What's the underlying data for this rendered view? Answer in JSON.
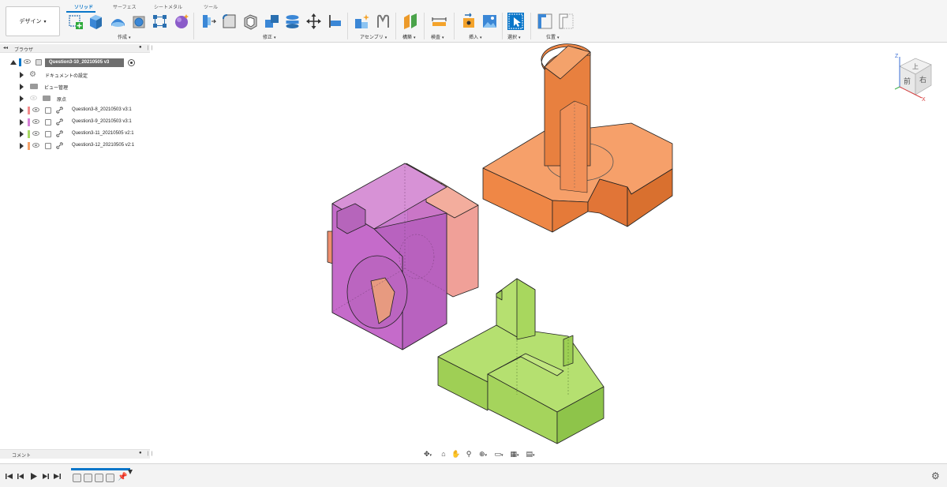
{
  "toolbar": {
    "workspace_label": "デザイン",
    "tabs": [
      "ソリッド",
      "サーフェス",
      "シートメタル",
      "ツール"
    ],
    "groups": [
      "作成",
      "修正",
      "アセンブリ",
      "構築",
      "検査",
      "挿入",
      "選択",
      "位置"
    ],
    "icon_names": {
      "create": [
        "create-sketch-icon",
        "extrude-icon",
        "revolve-icon",
        "hole-icon",
        "pattern-icon",
        "create-form-icon"
      ],
      "modify": [
        "press-pull-icon",
        "fillet-icon",
        "shell-icon",
        "combine-icon",
        "split-body-icon",
        "move-icon",
        "align-icon"
      ],
      "assembly": [
        "new-component-icon",
        "joint-icon"
      ],
      "construct": [
        "offset-plane-icon"
      ],
      "inspect": [
        "measure-icon"
      ],
      "insert": [
        "insert-derive-icon",
        "insert-image-icon"
      ],
      "select": [
        "select-cursor-icon"
      ],
      "position": [
        "capture-position-icon",
        "revert-position-icon"
      ]
    }
  },
  "browser": {
    "title": "ブラウザ",
    "root": "Question3-10_20210505 v3",
    "items": [
      {
        "label": "ドキュメントの設定",
        "type": "settings"
      },
      {
        "label": "ビュー管理",
        "type": "folder"
      },
      {
        "label": "原点",
        "type": "folder"
      },
      {
        "label": "Question3-8_20210503 v3:1",
        "type": "link",
        "color": "#f28b8b"
      },
      {
        "label": "Question3-9_20210503 v3:1",
        "type": "link",
        "color": "#d57fd5"
      },
      {
        "label": "Question3-11_20210505 v2:1",
        "type": "link",
        "color": "#a8d862"
      },
      {
        "label": "Question3-12_20210505 v2:1",
        "type": "link",
        "color": "#f4a26b"
      }
    ]
  },
  "comment": {
    "title": "コメント"
  },
  "viewcube": {
    "top": "上",
    "front": "前",
    "right": "右",
    "axis_z": "Z",
    "axis_x": "X"
  },
  "colors": {
    "accent": "#0a76c9",
    "orange": "#f48a4a",
    "magenta": "#c169c7",
    "green": "#a6d55e",
    "salmon": "#f2a090"
  },
  "navbar": {
    "icons": [
      "orbit-icon",
      "look-at-icon",
      "pan-icon",
      "zoom-icon",
      "fit-icon",
      "display-settings-icon",
      "grid-icon",
      "viewports-icon"
    ]
  },
  "timeline": {
    "icons": [
      "first-icon",
      "prev-icon",
      "play-icon",
      "next-icon",
      "last-icon"
    ],
    "items": 4
  }
}
